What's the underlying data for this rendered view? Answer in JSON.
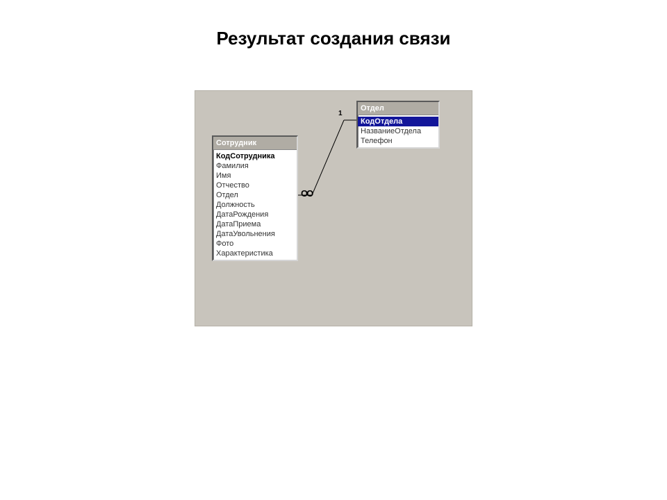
{
  "title": "Результат создания связи",
  "tables": {
    "employee": {
      "name": "Сотрудник",
      "fields": [
        {
          "label": "КодСотрудника",
          "pk": true
        },
        {
          "label": "Фамилия"
        },
        {
          "label": "Имя"
        },
        {
          "label": "Отчество"
        },
        {
          "label": "Отдел"
        },
        {
          "label": "Должность"
        },
        {
          "label": "ДатаРождения"
        },
        {
          "label": "ДатаПриема"
        },
        {
          "label": "ДатаУвольнения"
        },
        {
          "label": "Фото"
        },
        {
          "label": "Характеристика"
        }
      ]
    },
    "department": {
      "name": "Отдел",
      "fields": [
        {
          "label": "КодОтдела",
          "pk": true,
          "selected": true
        },
        {
          "label": "НазваниеОтдела"
        },
        {
          "label": "Телефон"
        }
      ]
    }
  },
  "relationship": {
    "one_label": "1",
    "many_label": "∞"
  }
}
